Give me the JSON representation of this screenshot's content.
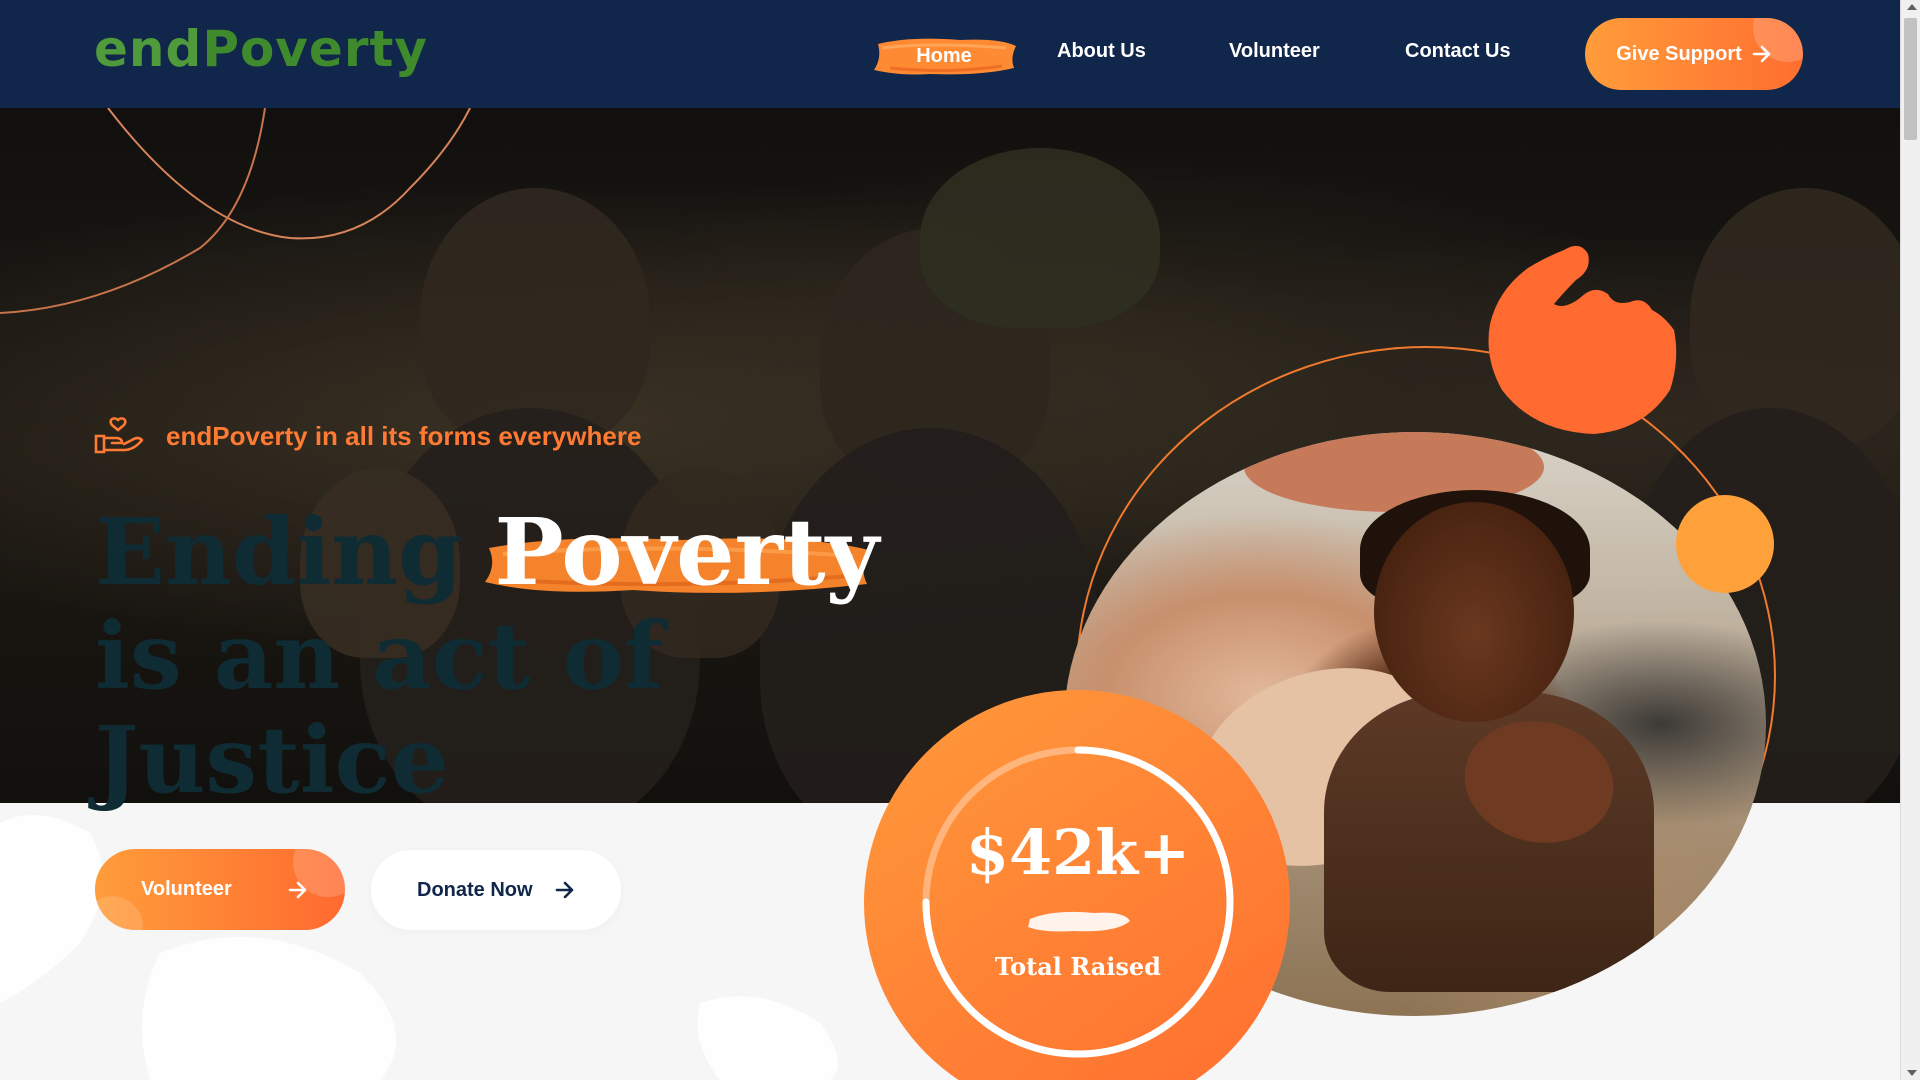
{
  "logo": {
    "part1": "end",
    "part2": "Poverty"
  },
  "nav": {
    "items": [
      {
        "label": "Home",
        "active": true
      },
      {
        "label": "About Us"
      },
      {
        "label": "Volunteer"
      },
      {
        "label": "Contact Us"
      }
    ],
    "cta_label": "Give Support"
  },
  "hero": {
    "tagline": "endPoverty in all its forms everywhere",
    "headline": {
      "before": "Ending ",
      "highlight": "Poverty",
      "line2": "is an act of",
      "line3": "Justice"
    },
    "buttons": {
      "volunteer": "Volunteer",
      "donate": "Donate Now"
    }
  },
  "stat": {
    "value": "$42k+",
    "label": "Total Raised"
  },
  "colors": {
    "navy": "#10264a",
    "orange": "#ff7a32",
    "orange_light": "#ffa13a",
    "green": "#4f9a3a"
  },
  "icons": {
    "arrow": "arrow-right-icon",
    "tagline_icon": "hand-heart-icon"
  }
}
